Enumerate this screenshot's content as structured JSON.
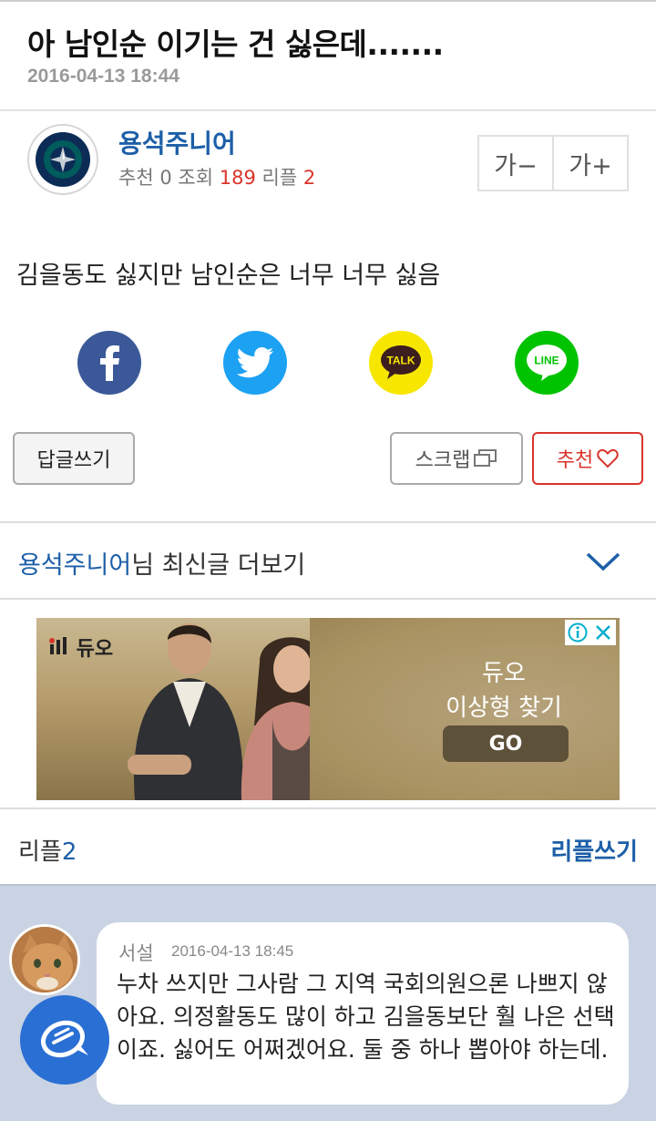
{
  "post": {
    "title": "아 남인순 이기는 건 싫은데.......",
    "date": "2016-04-13 18:44",
    "body": "김을동도 싫지만 남인순은 너무 너무 싫음"
  },
  "author": {
    "name": "용석주니어",
    "stats": {
      "recommend_label": "추천",
      "recommend_count": "0",
      "views_label": "조회",
      "views_count": "189",
      "replies_label": "리플",
      "replies_count": "2"
    },
    "badge_icon": "seattle-mariners-logo"
  },
  "font_controls": {
    "decrease": "가−",
    "increase": "가+"
  },
  "share": {
    "facebook_icon": "facebook-icon",
    "twitter_icon": "twitter-icon",
    "kakao_label": "TALK",
    "line_label": "LINE"
  },
  "actions": {
    "reply": "답글쓰기",
    "scrap": "스크랩",
    "recommend": "추천"
  },
  "more_posts": {
    "name": "용석주니어",
    "suffix": "님 최신글 더보기"
  },
  "ad": {
    "brand": "듀오",
    "title": "듀오",
    "subtitle": "이상형 찾기",
    "cta": "GO"
  },
  "replies": {
    "label": "리플",
    "count": "2",
    "write_label": "리플쓰기"
  },
  "comments": [
    {
      "author": "서설",
      "date": "2016-04-13 18:45",
      "text": "누차 쓰지만 그사람 그 지역 국회의원으론 나쁘지 않아요. 의정활동도 많이 하고 김을동보단 훨 나은 선택이죠. 싫어도 어쩌겠어요. 둘 중 하나 뽑아야 하는데."
    }
  ],
  "colors": {
    "link_blue": "#1d5fa8",
    "accent_red": "#d9342b",
    "comments_bg": "#c9d3e3",
    "fab_blue": "#2a6fd4"
  }
}
